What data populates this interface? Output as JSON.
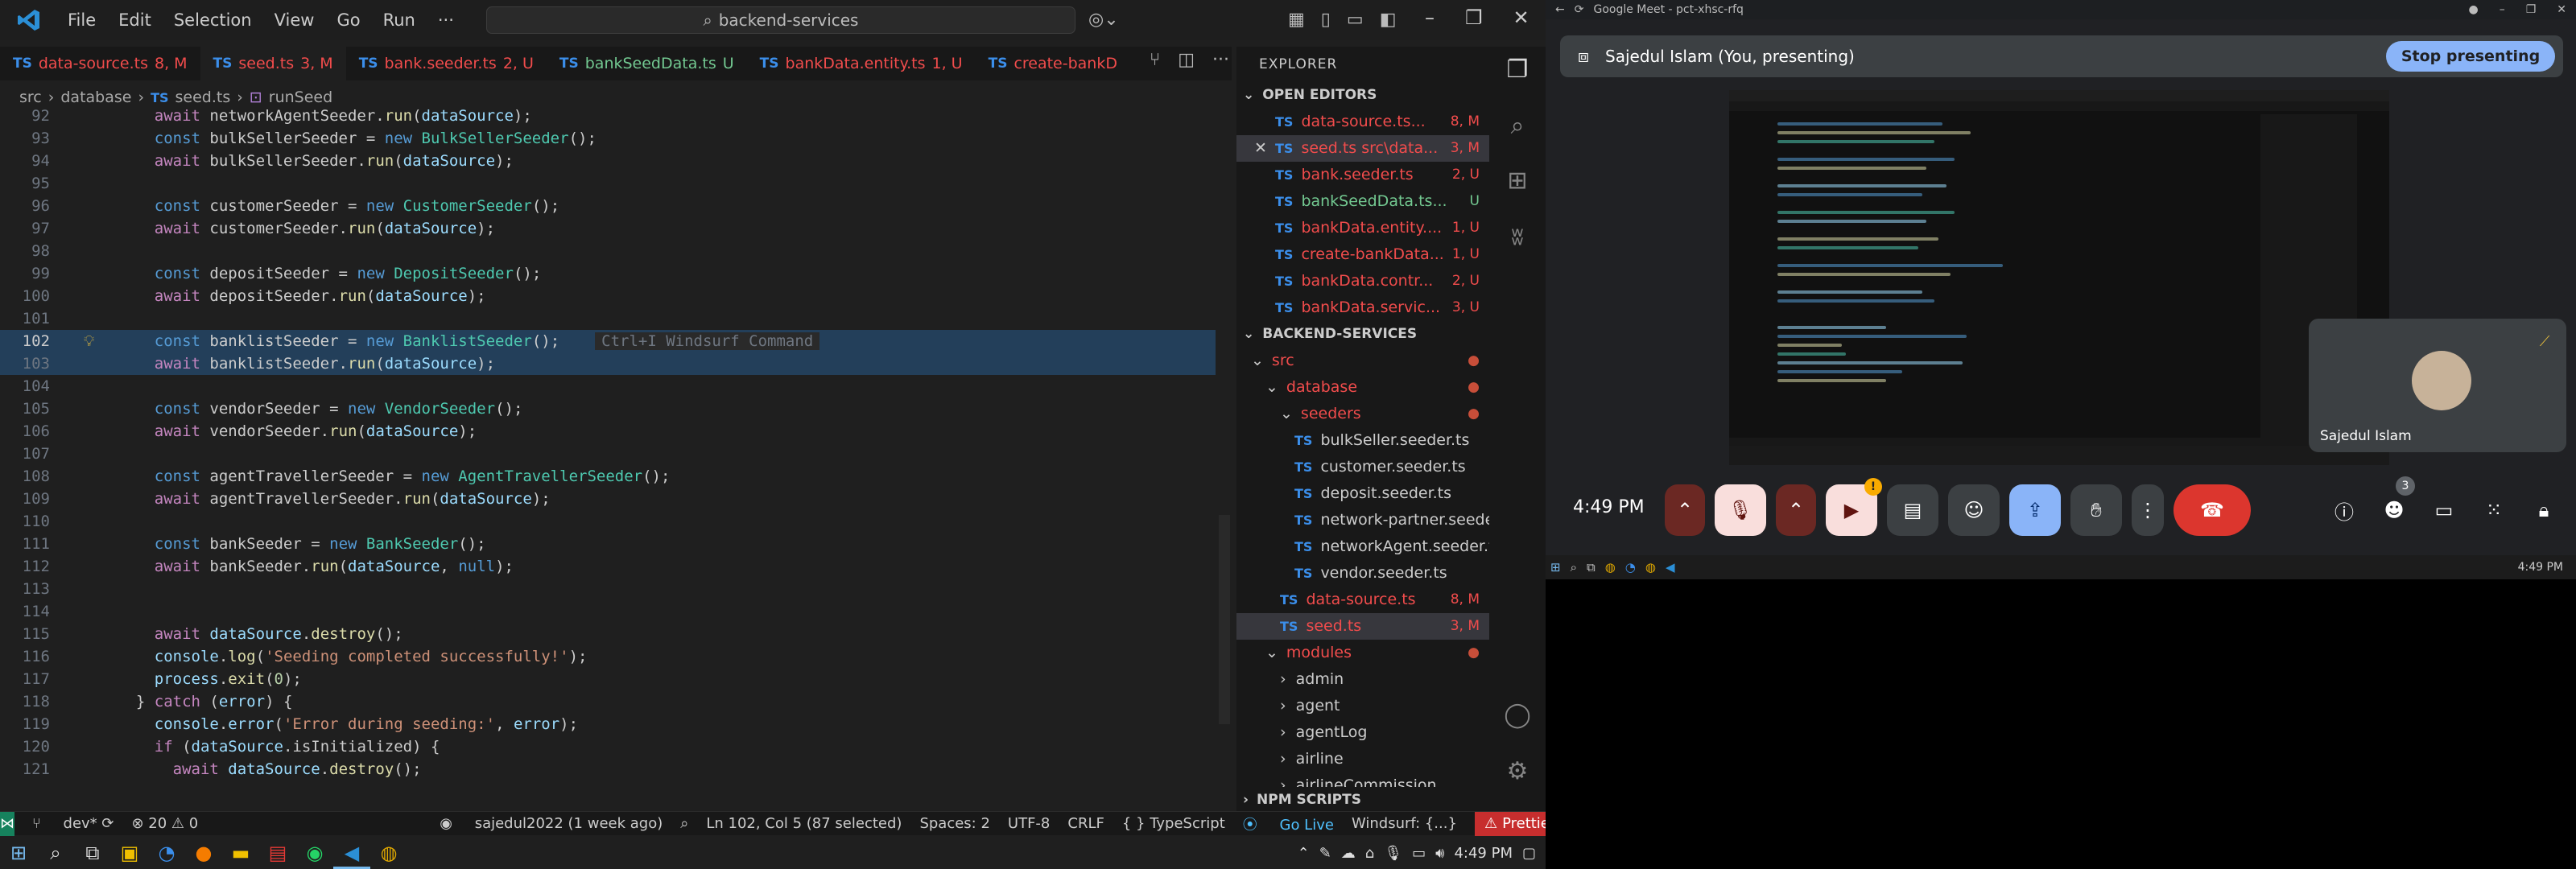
{
  "vscode": {
    "menu": [
      "File",
      "Edit",
      "Selection",
      "View",
      "Go",
      "Run",
      "···"
    ],
    "search_text": "backend-services",
    "tabs": [
      {
        "name": "data-source.ts",
        "badge": "8, M",
        "color": "#f14c4c"
      },
      {
        "name": "seed.ts",
        "badge": "3, M",
        "color": "#f14c4c",
        "active": true
      },
      {
        "name": "bank.seeder.ts",
        "badge": "2, U",
        "color": "#f14c4c"
      },
      {
        "name": "bankSeedData.ts",
        "badge": "U",
        "color": "#73c991"
      },
      {
        "name": "bankData.entity.ts",
        "badge": "1, U",
        "color": "#f14c4c"
      },
      {
        "name": "create-bankD",
        "badge": "",
        "color": "#f14c4c"
      }
    ],
    "breadcrumb": [
      "src",
      "database",
      "seed.ts",
      "runSeed"
    ],
    "hint": "Ctrl+I Windsurf Command",
    "lines": [
      {
        "n": "92",
        "code": "    await networkAgentSeeder.run(dataSource);"
      },
      {
        "n": "93",
        "code": "    const bulkSellerSeeder = new BulkSellerSeeder();"
      },
      {
        "n": "94",
        "code": "    await bulkSellerSeeder.run(dataSource);"
      },
      {
        "n": "95",
        "code": ""
      },
      {
        "n": "96",
        "code": "    const customerSeeder = new CustomerSeeder();"
      },
      {
        "n": "97",
        "code": "    await customerSeeder.run(dataSource);"
      },
      {
        "n": "98",
        "code": ""
      },
      {
        "n": "99",
        "code": "    const depositSeeder = new DepositSeeder();"
      },
      {
        "n": "100",
        "code": "    await depositSeeder.run(dataSource);"
      },
      {
        "n": "101",
        "code": ""
      },
      {
        "n": "102",
        "code": "    const banklistSeeder = new BanklistSeeder();"
      },
      {
        "n": "103",
        "code": "    await banklistSeeder.run(dataSource);"
      },
      {
        "n": "104",
        "code": ""
      },
      {
        "n": "105",
        "code": "    const vendorSeeder = new VendorSeeder();"
      },
      {
        "n": "106",
        "code": "    await vendorSeeder.run(dataSource);"
      },
      {
        "n": "107",
        "code": ""
      },
      {
        "n": "108",
        "code": "    const agentTravellerSeeder = new AgentTravellerSeeder();"
      },
      {
        "n": "109",
        "code": "    await agentTravellerSeeder.run(dataSource);"
      },
      {
        "n": "110",
        "code": ""
      },
      {
        "n": "111",
        "code": "    const bankSeeder = new BankSeeder();"
      },
      {
        "n": "112",
        "code": "    await bankSeeder.run(dataSource, null);"
      },
      {
        "n": "113",
        "code": ""
      },
      {
        "n": "114",
        "code": ""
      },
      {
        "n": "115",
        "code": "    await dataSource.destroy();"
      },
      {
        "n": "116",
        "code": "    console.log('Seeding completed successfully!');"
      },
      {
        "n": "117",
        "code": "    process.exit(0);"
      },
      {
        "n": "118",
        "code": "  } catch (error) {"
      },
      {
        "n": "119",
        "code": "    console.error('Error during seeding:', error);"
      },
      {
        "n": "120",
        "code": "    if (dataSource.isInitialized) {"
      },
      {
        "n": "121",
        "code": "      await dataSource.destroy();"
      }
    ],
    "explorer": {
      "title": "EXPLORER",
      "open_editors_label": "OPEN EDITORS",
      "open_editors": [
        {
          "name": "data-source.ts...",
          "badge": "8, M",
          "color": "#f14c4c"
        },
        {
          "name": "seed.ts  src\\data...",
          "badge": "3, M",
          "color": "#f14c4c",
          "active": true
        },
        {
          "name": "bank.seeder.ts",
          "badge": "2, U",
          "color": "#f14c4c"
        },
        {
          "name": "bankSeedData.ts...",
          "badge": "U",
          "color": "#73c991"
        },
        {
          "name": "bankData.entity....",
          "badge": "1, U",
          "color": "#f14c4c"
        },
        {
          "name": "create-bankData...",
          "badge": "1, U",
          "color": "#f14c4c"
        },
        {
          "name": "bankData.contr...",
          "badge": "2, U",
          "color": "#f14c4c"
        },
        {
          "name": "bankData.servic...",
          "badge": "3, U",
          "color": "#f14c4c"
        }
      ],
      "project_label": "BACKEND-SERVICES",
      "tree": [
        {
          "name": "src",
          "kind": "folder",
          "indent": 1,
          "color": "#f14c4c",
          "dot": true
        },
        {
          "name": "database",
          "kind": "folder",
          "indent": 2,
          "color": "#f14c4c",
          "dot": true
        },
        {
          "name": "seeders",
          "kind": "folder",
          "indent": 3,
          "color": "#f14c4c",
          "dot": true
        },
        {
          "name": "bulkSeller.seeder.ts",
          "kind": "file",
          "indent": 4,
          "color": "#cccccc"
        },
        {
          "name": "customer.seeder.ts",
          "kind": "file",
          "indent": 4,
          "color": "#cccccc"
        },
        {
          "name": "deposit.seeder.ts",
          "kind": "file",
          "indent": 4,
          "color": "#cccccc"
        },
        {
          "name": "network-partner.seeder.ts",
          "kind": "file",
          "indent": 4,
          "color": "#cccccc"
        },
        {
          "name": "networkAgent.seeder.ts",
          "kind": "file",
          "indent": 4,
          "color": "#cccccc"
        },
        {
          "name": "vendor.seeder.ts",
          "kind": "file",
          "indent": 4,
          "color": "#cccccc"
        },
        {
          "name": "data-source.ts",
          "kind": "file",
          "indent": 3,
          "color": "#f14c4c",
          "badge": "8, M"
        },
        {
          "name": "seed.ts",
          "kind": "file",
          "indent": 3,
          "color": "#f14c4c",
          "badge": "3, M",
          "active": true
        },
        {
          "name": "modules",
          "kind": "folder",
          "indent": 2,
          "color": "#f14c4c",
          "dot": true
        },
        {
          "name": "admin",
          "kind": "folder-closed",
          "indent": 3,
          "color": "#cccccc"
        },
        {
          "name": "agent",
          "kind": "folder-closed",
          "indent": 3,
          "color": "#cccccc"
        },
        {
          "name": "agentLog",
          "kind": "folder-closed",
          "indent": 3,
          "color": "#cccccc"
        },
        {
          "name": "airline",
          "kind": "folder-closed",
          "indent": 3,
          "color": "#cccccc"
        },
        {
          "name": "airlineCommission",
          "kind": "folder-closed",
          "indent": 3,
          "color": "#cccccc"
        }
      ],
      "npm_label": "NPM SCRIPTS"
    },
    "status": {
      "branch": "dev*",
      "problems": "⊗ 20 ⚠ 0",
      "blame": "sajedul2022 (1 week ago)",
      "position": "Ln 102, Col 5 (87 selected)",
      "spaces": "Spaces: 2",
      "encoding": "UTF-8",
      "eol": "CRLF",
      "language": "{ } TypeScript",
      "golive": "Go Live",
      "windsurf": "Windsurf: {...}",
      "prettier": "Prettier"
    }
  },
  "meet": {
    "chrome_title": "Google Meet - pct-xhsc-rfq",
    "presenting_label": "Sajedul Islam (You, presenting)",
    "stop_label": "Stop presenting",
    "self_name": "Sajedul Islam",
    "time": "4:49 PM",
    "participants_count": "3",
    "taskbar_clock": "4:49 PM"
  },
  "taskbar": {
    "clock": "4:49 PM"
  }
}
